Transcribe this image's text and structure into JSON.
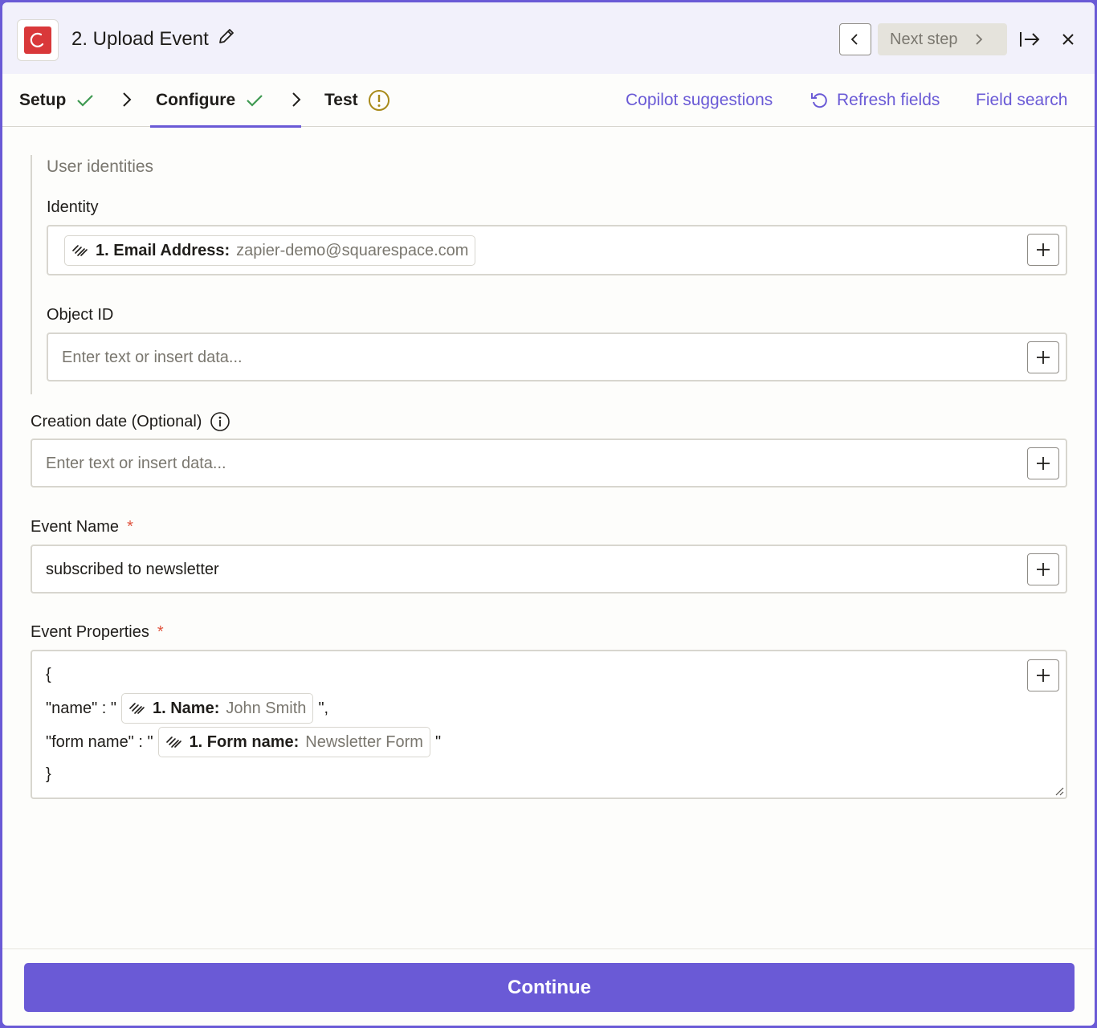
{
  "header": {
    "title": "2. Upload Event",
    "next_step_label": "Next step",
    "logo_color": "#d9383a"
  },
  "tabs": [
    {
      "label": "Setup",
      "status": "complete"
    },
    {
      "label": "Configure",
      "status": "complete"
    },
    {
      "label": "Test",
      "status": "warning"
    }
  ],
  "actions": {
    "copilot": "Copilot suggestions",
    "refresh": "Refresh fields",
    "field_search": "Field search"
  },
  "form": {
    "section_title": "User identities",
    "identity": {
      "label": "Identity",
      "pill_key": "1. Email Address:",
      "pill_value": "zapier-demo@squarespace.com"
    },
    "object_id": {
      "label": "Object ID",
      "placeholder": "Enter text or insert data..."
    },
    "creation_date": {
      "label": "Creation date (Optional)",
      "placeholder": "Enter text or insert data..."
    },
    "event_name": {
      "label": "Event Name",
      "required_mark": "*",
      "value": "subscribed to newsletter"
    },
    "event_properties": {
      "label": "Event Properties",
      "required_mark": "*",
      "open_brace": "{",
      "close_brace": "}",
      "line1_prefix": "\"name\" : \"",
      "line1_pill_key": "1. Name:",
      "line1_pill_value": "John Smith",
      "line1_suffix": "\",",
      "line2_prefix": "\"form name\" : \"",
      "line2_pill_key": "1. Form name:",
      "line2_pill_value": "Newsletter Form",
      "line2_suffix": "\""
    }
  },
  "footer": {
    "continue_label": "Continue"
  },
  "colors": {
    "accent": "#6a5ad6",
    "success": "#3f9a52",
    "warning": "#a88a1a",
    "required": "#e0533d"
  }
}
